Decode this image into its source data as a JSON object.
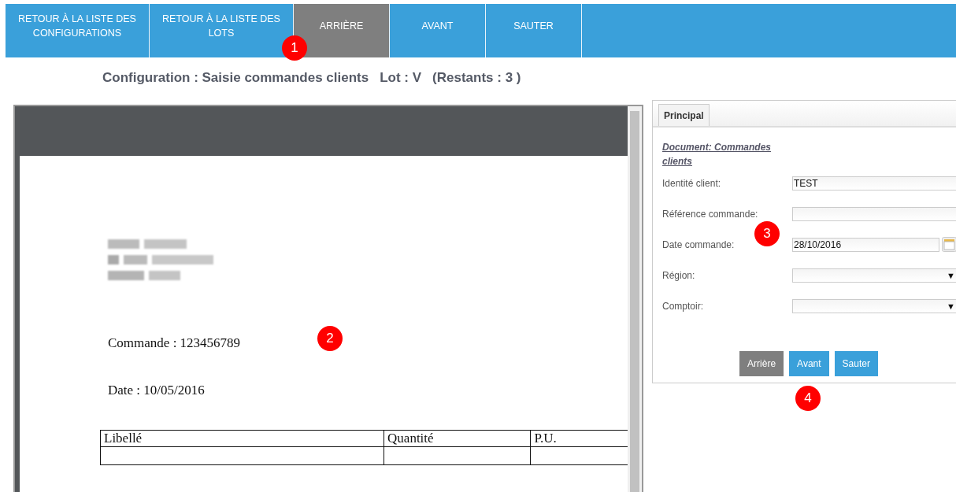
{
  "nav": [
    {
      "label": "RETOUR À LA LISTE DES CONFIGURATIONS",
      "selected": false
    },
    {
      "label": "RETOUR À LA LISTE DES LOTS",
      "selected": false
    },
    {
      "label": "ARRIÈRE",
      "selected": true
    },
    {
      "label": "AVANT",
      "selected": false
    },
    {
      "label": "SAUTER",
      "selected": false
    }
  ],
  "heading": [
    "Configuration : Saisie commandes clients",
    "Lot : V",
    "(Restants : 3 )"
  ],
  "document": {
    "lines": [
      "Commande : 123456789",
      "Date : 10/05/2016"
    ],
    "table": {
      "columns": [
        "Libellé",
        "Quantité",
        "P.U."
      ]
    }
  },
  "panel": {
    "tabs": [
      {
        "label": "Principal",
        "selected": true
      }
    ],
    "doc_link": "Document: Commandes clients",
    "fields": [
      {
        "kind": "text",
        "label": "Identité client:",
        "value": "TEST"
      },
      {
        "kind": "text",
        "label": "Référence commande:"
      },
      {
        "kind": "date",
        "label": "Date commande:",
        "value": "28/10/2016"
      },
      {
        "kind": "select",
        "label": "Région:",
        "arrow": "▼"
      },
      {
        "kind": "select",
        "label": "Comptoir:",
        "arrow": "▼"
      }
    ],
    "buttons": [
      {
        "label": "Arrière",
        "disabled": true
      },
      {
        "label": "Avant",
        "disabled": false
      },
      {
        "label": "Sauter",
        "disabled": false
      }
    ]
  },
  "markers": [
    "1",
    "2",
    "3",
    "4"
  ]
}
